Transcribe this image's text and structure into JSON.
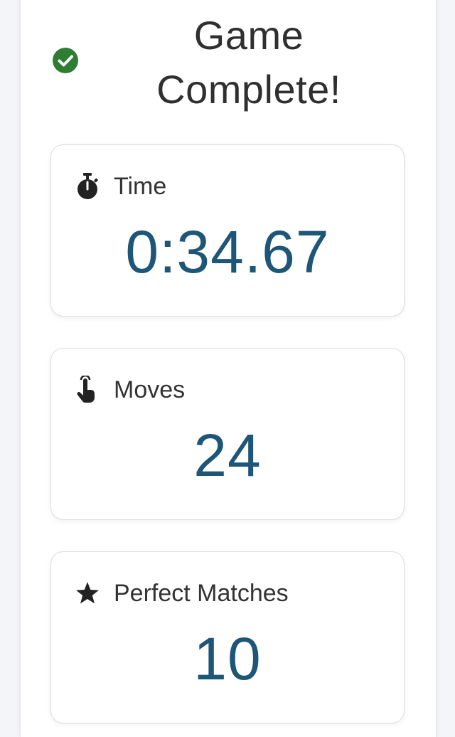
{
  "header": {
    "title_line1": "Game",
    "title_line2": "Complete!",
    "status_icon": "check-circle-icon",
    "status_color": "#2e7d32"
  },
  "stats": {
    "time": {
      "label": "Time",
      "value": "0:34.67",
      "icon": "stopwatch-icon"
    },
    "moves": {
      "label": "Moves",
      "value": "24",
      "icon": "tap-hand-icon"
    },
    "perfect": {
      "label": "Perfect Matches",
      "value": "10",
      "icon": "star-icon"
    }
  },
  "colors": {
    "value_text": "#1e5677",
    "label_text": "#333333",
    "card_border": "#d9dde3",
    "background": "#f4f5f8"
  }
}
